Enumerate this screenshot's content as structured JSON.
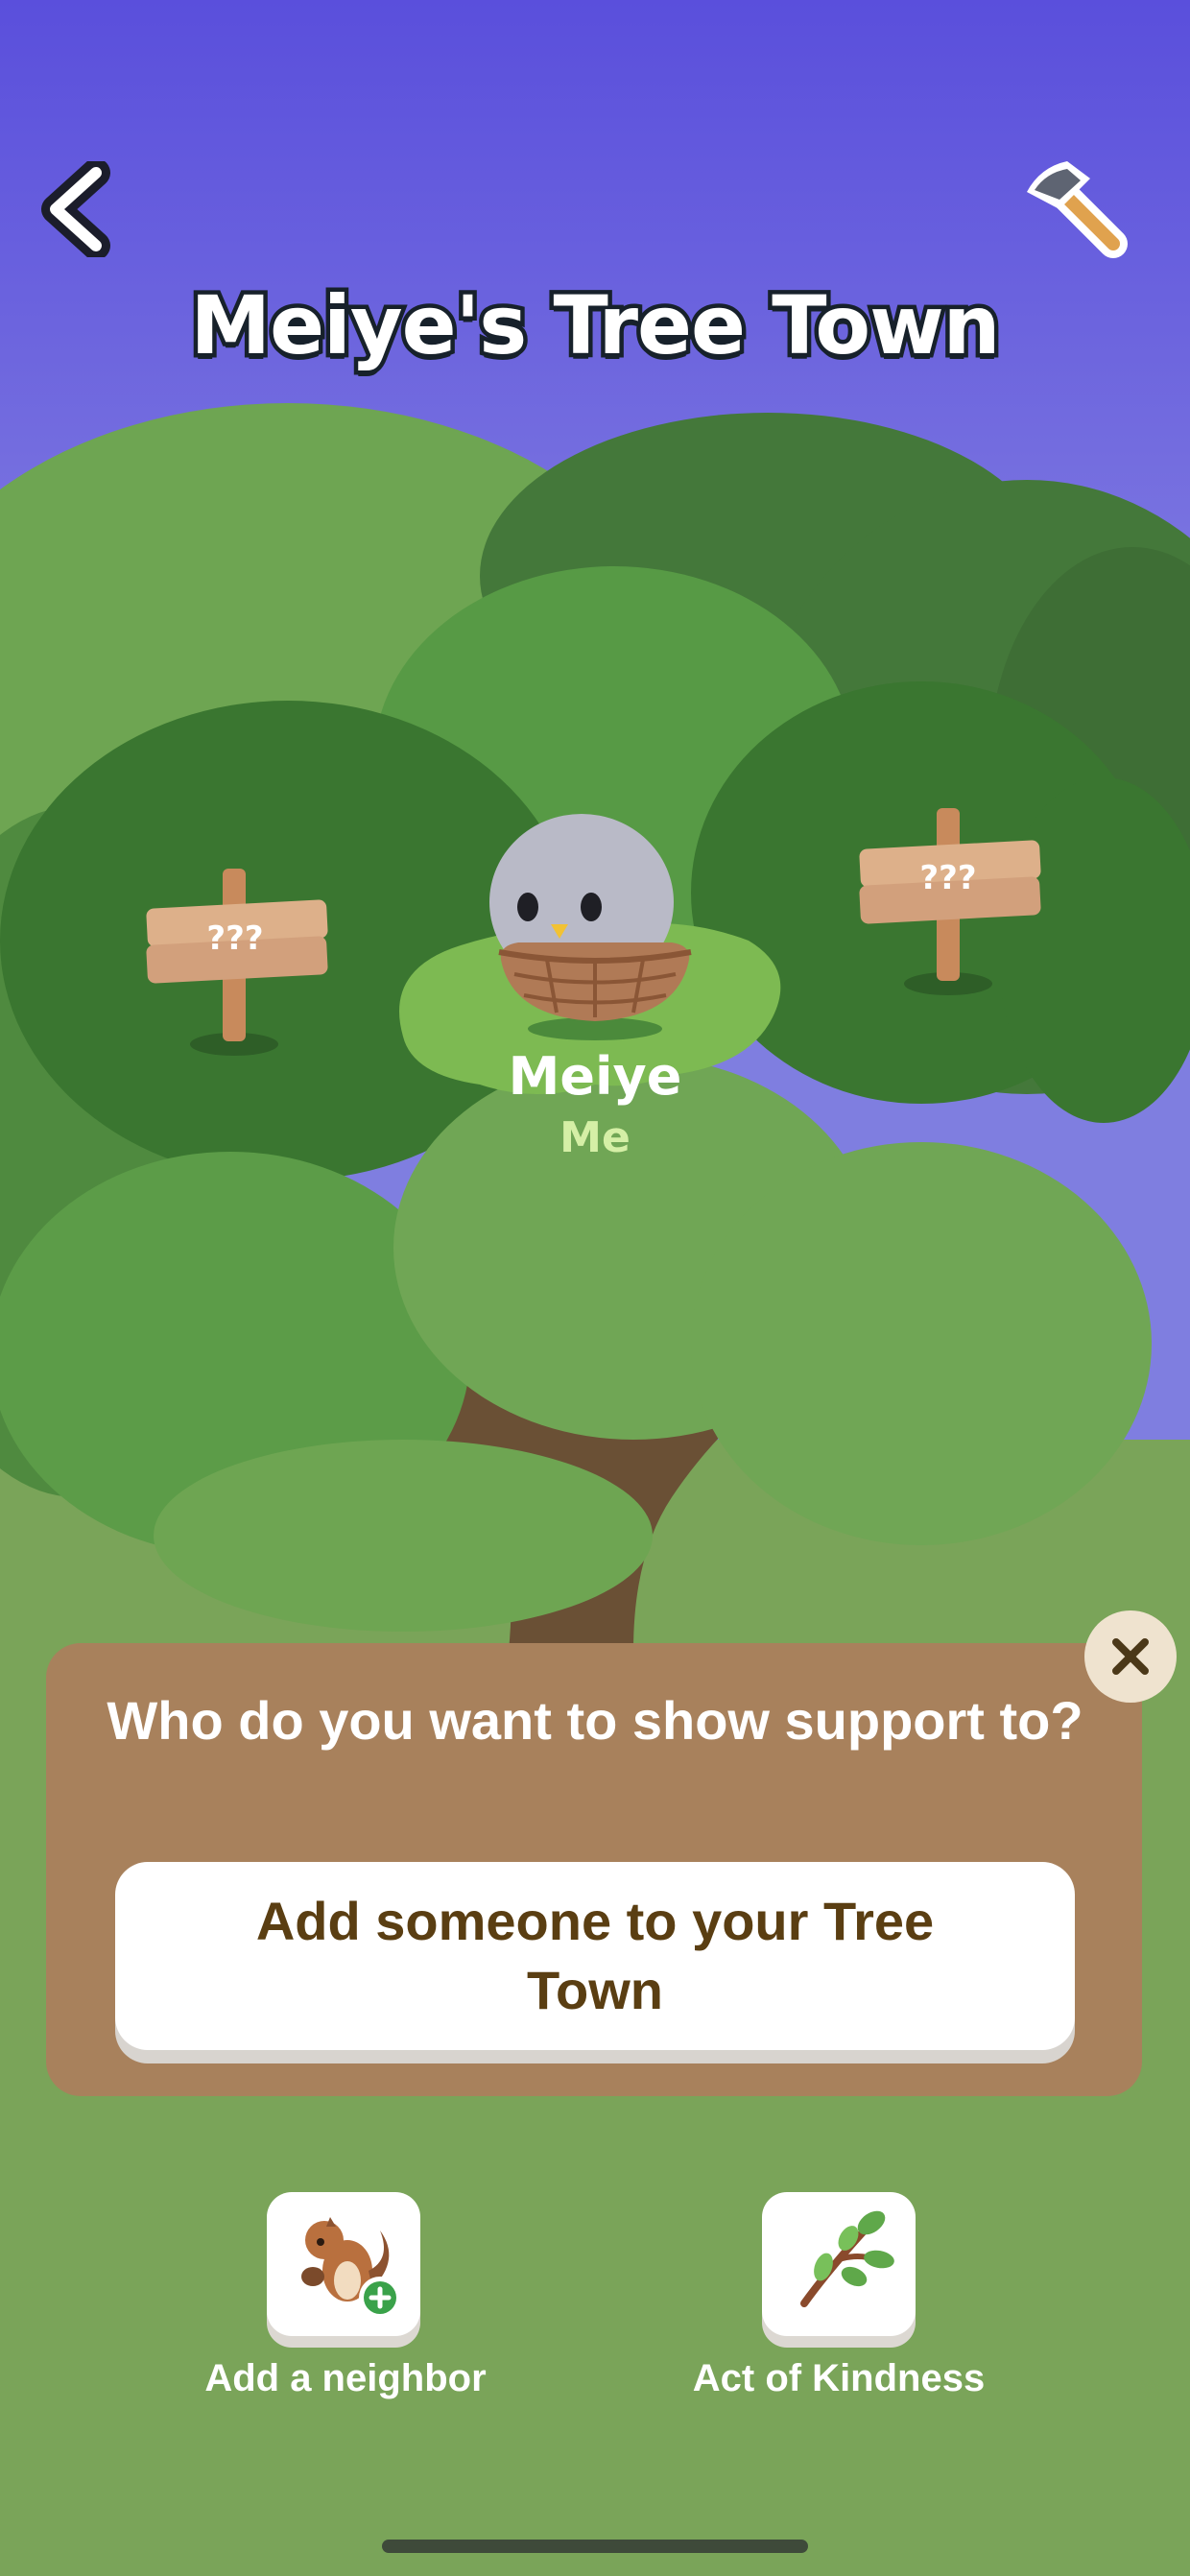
{
  "header": {
    "title": "Meiye's Tree Town",
    "back_icon": "chevron-left-icon",
    "build_icon": "hammer-icon"
  },
  "tree": {
    "signs": [
      {
        "label": "???"
      },
      {
        "label": "???"
      }
    ],
    "me": {
      "name": "Meiye",
      "tag": "Me"
    }
  },
  "support_panel": {
    "question": "Who do you want to show support to?",
    "add_button_label": "Add someone to your Tree Town",
    "close_icon": "close-icon"
  },
  "actions": [
    {
      "label": "Add a neighbor",
      "icon": "chipmunk-add-icon"
    },
    {
      "label": "Act of Kindness",
      "icon": "sprout-branch-icon"
    }
  ],
  "colors": {
    "sky_top": "#5a4fdc",
    "sky_bottom": "#7f7ee0",
    "panel": "#a8815c",
    "ground": "#7aa459",
    "button_text": "#5a3e12"
  }
}
